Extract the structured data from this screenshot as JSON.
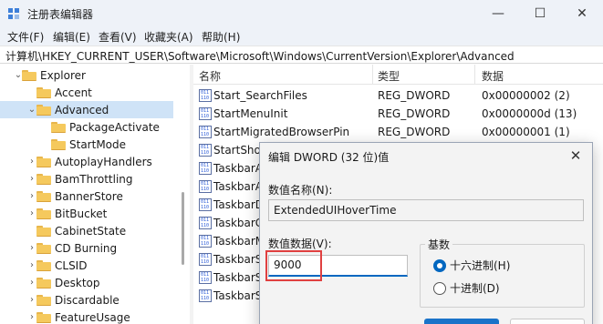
{
  "window": {
    "title": "注册表编辑器",
    "minimize": "—",
    "maximize": "☐",
    "close": "✕"
  },
  "menu": [
    "文件(F)",
    "编辑(E)",
    "查看(V)",
    "收藏夹(A)",
    "帮助(H)"
  ],
  "address": "计算机\\HKEY_CURRENT_USER\\Software\\Microsoft\\Windows\\CurrentVersion\\Explorer\\Advanced",
  "tree": {
    "items": [
      {
        "label": "Explorer",
        "expanded": true
      },
      {
        "label": "Accent",
        "expanded": false
      },
      {
        "label": "Advanced",
        "expanded": true,
        "selected": true
      },
      {
        "label": "PackageActivate",
        "expanded": false
      },
      {
        "label": "StartMode",
        "expanded": false
      },
      {
        "label": "AutoplayHandlers",
        "expanded": false
      },
      {
        "label": "BamThrottling",
        "expanded": false
      },
      {
        "label": "BannerStore",
        "expanded": false
      },
      {
        "label": "BitBucket",
        "expanded": false
      },
      {
        "label": "CabinetState",
        "expanded": false
      },
      {
        "label": "CD Burning",
        "expanded": false
      },
      {
        "label": "CLSID",
        "expanded": false
      },
      {
        "label": "Desktop",
        "expanded": false
      },
      {
        "label": "Discardable",
        "expanded": false
      },
      {
        "label": "FeatureUsage",
        "expanded": false
      }
    ]
  },
  "list": {
    "headers": {
      "name": "名称",
      "type": "类型",
      "data": "数据"
    },
    "rows": [
      {
        "name": "Start_SearchFiles",
        "type": "REG_DWORD",
        "data": "0x00000002 (2)"
      },
      {
        "name": "StartMenuInit",
        "type": "REG_DWORD",
        "data": "0x0000000d (13)"
      },
      {
        "name": "StartMigratedBrowserPin",
        "type": "REG_DWORD",
        "data": "0x00000001 (1)"
      },
      {
        "name": "StartShow",
        "type": "",
        "data": ""
      },
      {
        "name": "TaskbarA",
        "type": "",
        "data": ""
      },
      {
        "name": "TaskbarA",
        "type": "",
        "data": ""
      },
      {
        "name": "TaskbarD",
        "type": "",
        "data": ""
      },
      {
        "name": "TaskbarG",
        "type": "",
        "data": ""
      },
      {
        "name": "TaskbarM",
        "type": "",
        "data": ""
      },
      {
        "name": "TaskbarS",
        "type": "",
        "data": ""
      },
      {
        "name": "TaskbarS",
        "type": "",
        "data": ""
      },
      {
        "name": "TaskbarS",
        "type": "",
        "data": ""
      }
    ]
  },
  "dialog": {
    "title": "编辑 DWORD (32 位)值",
    "close": "✕",
    "name_label": "数值名称(N):",
    "name_value": "ExtendedUIHoverTime",
    "data_label": "数值数据(V):",
    "data_value": "9000",
    "base_label": "基数",
    "base_hex": "十六进制(H)",
    "base_dec": "十进制(D)",
    "base_selected": "hex"
  },
  "colors": {
    "accent": "#0067c0",
    "highlight_box": "#e04040",
    "selection": "#cfe3f7",
    "folder": "#f5c95d"
  }
}
